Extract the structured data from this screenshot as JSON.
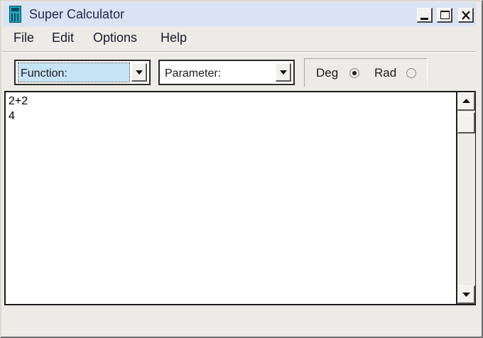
{
  "window": {
    "title": "Super Calculator"
  },
  "title_buttons": {
    "minimize": "minimize-icon",
    "maximize": "maximize-icon",
    "close": "close-icon"
  },
  "menu": {
    "items": [
      "File",
      "Edit",
      "Options",
      "Help"
    ]
  },
  "toolbar": {
    "function_combo": "Function:",
    "parameter_combo": "Parameter:",
    "angle_mode": {
      "deg_label": "Deg",
      "rad_label": "Rad",
      "selected": "Deg"
    }
  },
  "output": {
    "lines": [
      "2+2",
      "4"
    ]
  },
  "colors": {
    "titlebar": "#dae3f3",
    "selection": "#c5e3f4",
    "window_bg": "#ecebe6"
  }
}
